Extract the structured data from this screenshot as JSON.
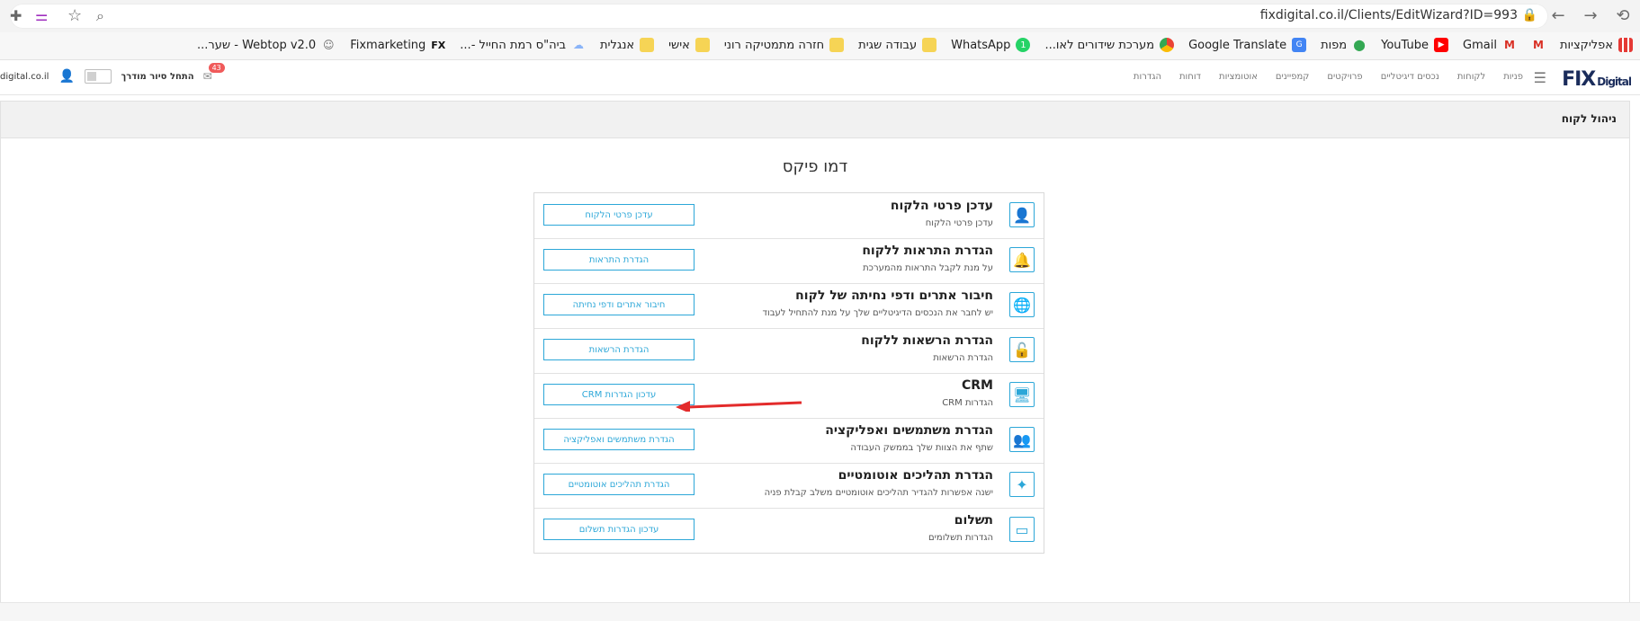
{
  "browser": {
    "url": "fixdigital.co.il/Clients/EditWizard?ID=993",
    "bookmarks": [
      {
        "label": "אפליקציות",
        "icon": "apps-icon"
      },
      {
        "label": "",
        "icon": "gmail-icon"
      },
      {
        "label": "Gmail",
        "icon": "gmail-icon"
      },
      {
        "label": "YouTube",
        "icon": "youtube-icon"
      },
      {
        "label": "מפות",
        "icon": "maps-icon"
      },
      {
        "label": "Google Translate",
        "icon": "translate-icon"
      },
      {
        "label": "מערכת שידורים לאו...",
        "icon": "chrome-icon"
      },
      {
        "label": "WhatsApp",
        "icon": "whatsapp-icon"
      },
      {
        "label": "עבודה שגית",
        "icon": "folder-icon"
      },
      {
        "label": "חזרה מתמטיקה רוני",
        "icon": "folder-icon"
      },
      {
        "label": "אישי",
        "icon": "folder-icon"
      },
      {
        "label": "אנגלית",
        "icon": "folder-icon"
      },
      {
        "label": "ביה\"ס רמת החייל -...",
        "icon": "cloud-icon"
      },
      {
        "label": "Fixmarketing",
        "icon": "fx-icon"
      },
      {
        "label": "Webtop v2.0 - שער...",
        "icon": "mask-icon"
      }
    ]
  },
  "app": {
    "logo_text": "FIX",
    "logo_suffix": "Digital",
    "nav": [
      "פניות",
      "לקוחות",
      "נכסים דיגיטליים",
      "פרויקטים",
      "קמפיינים",
      "אוטומציות",
      "דוחות",
      "הגדרות"
    ],
    "user": {
      "site": "digital.co.il",
      "toggle_label": "התחל סיור מודרך",
      "notifications": "43"
    }
  },
  "panel": {
    "title": "ניהול לקוח",
    "page_title": "דמו פיקס"
  },
  "rows": [
    {
      "title": "עדכן פרטי הלקוח",
      "subtitle": "עדכן פרטי הלקוח",
      "button": "עדכן פרטי הלקוח",
      "icon": "user-icon"
    },
    {
      "title": "הגדרת התראות ללקוח",
      "subtitle": "על מנת לקבל התראות מהמערכת",
      "button": "הגדרת התראות",
      "icon": "bell-icon"
    },
    {
      "title": "חיבור אתרים ודפי נחיתה של לקוח",
      "subtitle": "יש לחבר את הנכסים הדיגיטליים שלך על מנת להתחיל לעבוד",
      "button": "חיבור אתרים ודפי נחיתה",
      "icon": "globe-icon"
    },
    {
      "title": "הגדרת הרשאות ללקוח",
      "subtitle": "הגדרת הרשאות",
      "button": "הגדרת הרשאות",
      "icon": "unlock-icon"
    },
    {
      "title": "CRM",
      "subtitle": "הגדרות CRM",
      "button": "עדכון הגדרות CRM",
      "icon": "monitor-icon"
    },
    {
      "title": "הגדרת משתמשים ואפליקציה",
      "subtitle": "שתף את הצוות שלך בממשק העבודה",
      "button": "הגדרת משתמשים ואפליקציה",
      "icon": "users-icon"
    },
    {
      "title": "הגדרת תהליכים אוטומטיים",
      "subtitle": "ישנה אפשרות להגדיר תהליכים אוטומטיים משלב קבלת פניה",
      "button": "הגדרת תהליכים אוטומטיים",
      "icon": "magic-wand-icon"
    },
    {
      "title": "תשלום",
      "subtitle": "הגדרות תשלומים",
      "button": "עדכון הגדרות תשלום",
      "icon": "credit-card-icon"
    }
  ]
}
